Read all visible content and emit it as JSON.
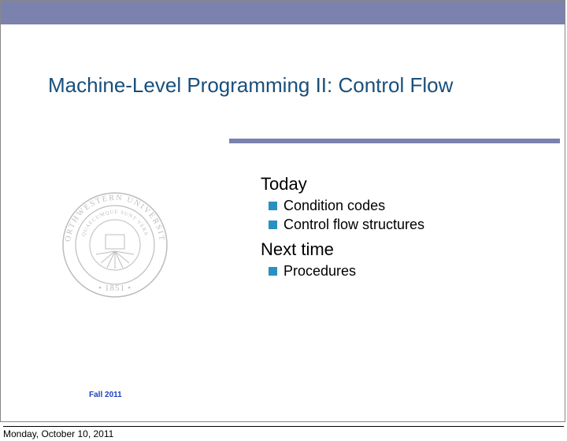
{
  "slide": {
    "title": "Machine-Level Programming II: Control Flow",
    "sections": {
      "today": {
        "heading": "Today",
        "items": [
          "Condition codes",
          "Control flow structures"
        ]
      },
      "next": {
        "heading": "Next time",
        "items": [
          "Procedures"
        ]
      }
    },
    "seal": {
      "top_text": "NORTHWESTERN UNIVERSITY",
      "motto": "QUAECUMQUE SUNT VERA",
      "year": "1851"
    },
    "term": "Fall 2011"
  },
  "footer": {
    "date": "Monday, October 10, 2011"
  },
  "colors": {
    "bar": "#7a82ad",
    "title": "#194f7b",
    "bullet": "#2a90c0",
    "term": "#1a3fc4"
  }
}
